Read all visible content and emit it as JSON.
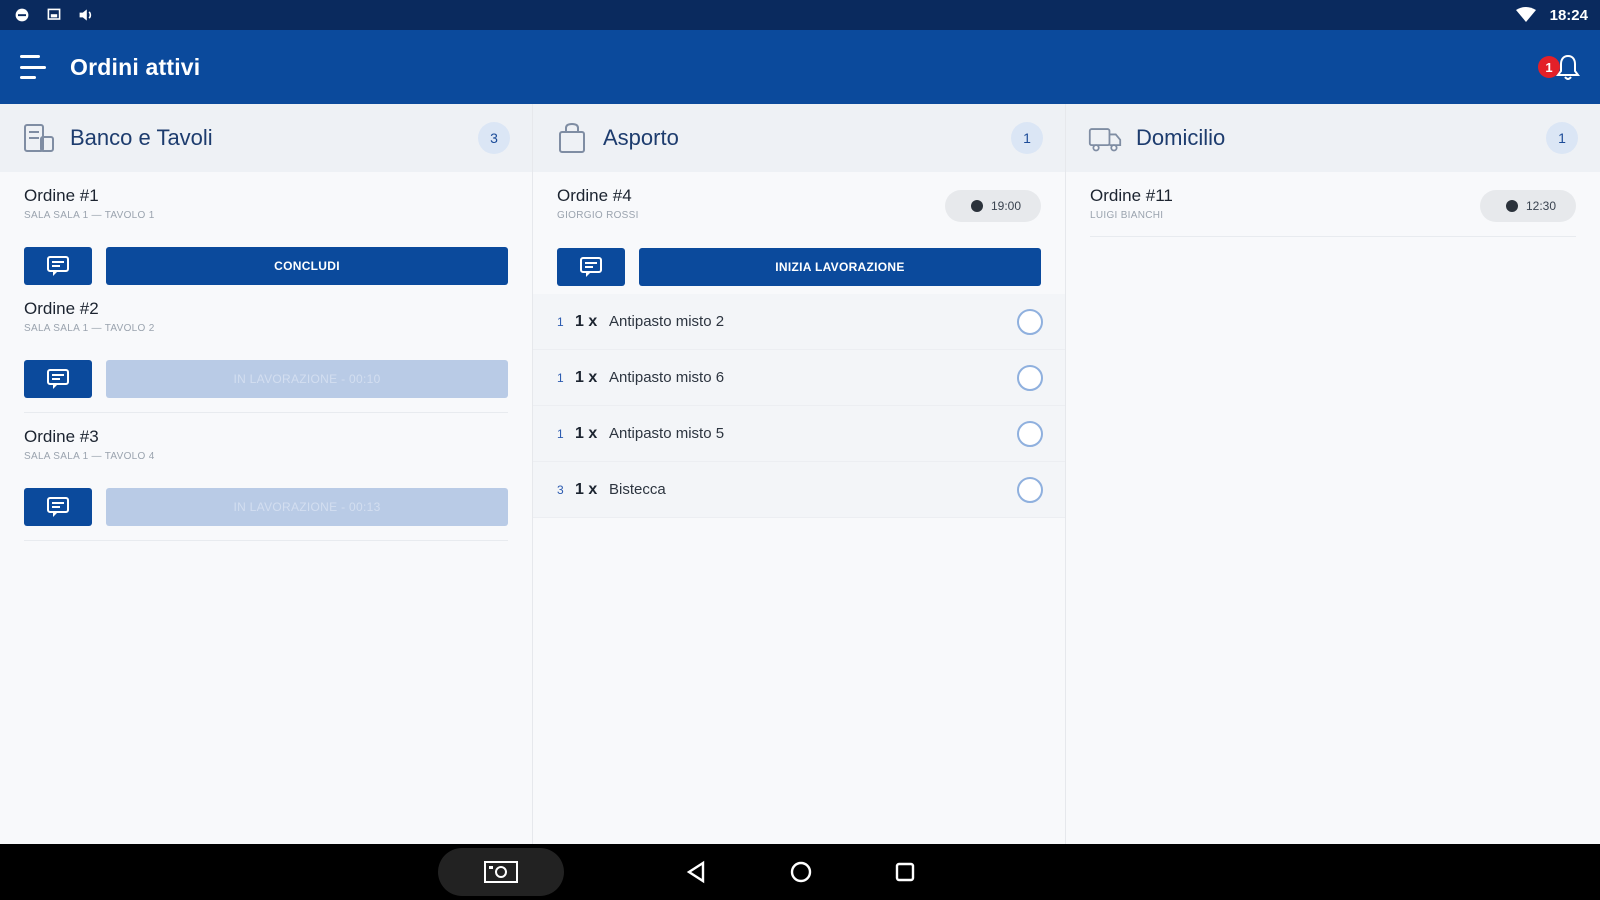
{
  "status_bar": {
    "time": "18:24"
  },
  "app_bar": {
    "title": "Ordini attivi",
    "notification_count": "1"
  },
  "columns": [
    {
      "title": "Banco e Tavoli",
      "count": "3",
      "icon": "receipt-icon",
      "orders": [
        {
          "name": "Ordine #1",
          "sub": "SALA SALA 1 — TAVOLO 1",
          "action": "CONCLUDI",
          "action_disabled": false
        },
        {
          "name": "Ordine #2",
          "sub": "SALA SALA 1 — TAVOLO 2",
          "action": "IN LAVORAZIONE - 00:10",
          "action_disabled": true
        },
        {
          "name": "Ordine #3",
          "sub": "SALA SALA 1 — TAVOLO 4",
          "action": "IN LAVORAZIONE - 00:13",
          "action_disabled": true
        }
      ]
    },
    {
      "title": "Asporto",
      "count": "1",
      "icon": "bag-icon",
      "orders": [
        {
          "name": "Ordine #4",
          "sub": "GIORGIO ROSSI",
          "time": "19:00",
          "action": "INIZIA LAVORAZIONE",
          "action_disabled": false,
          "items": [
            {
              "idx": "1",
              "qty": "1 x",
              "name": "Antipasto misto 2"
            },
            {
              "idx": "1",
              "qty": "1 x",
              "name": "Antipasto misto 6"
            },
            {
              "idx": "1",
              "qty": "1 x",
              "name": "Antipasto misto 5"
            },
            {
              "idx": "3",
              "qty": "1 x",
              "name": "Bistecca"
            }
          ]
        }
      ]
    },
    {
      "title": "Domicilio",
      "count": "1",
      "icon": "truck-icon",
      "orders": [
        {
          "name": "Ordine #11",
          "sub": "LUIGI BIANCHI",
          "time": "12:30"
        }
      ]
    }
  ],
  "colors": {
    "primary": "#0b4a9c",
    "status_bar": "#0a2a5e",
    "badge_red": "#e32028",
    "disabled_button": "#b9cbe6"
  }
}
